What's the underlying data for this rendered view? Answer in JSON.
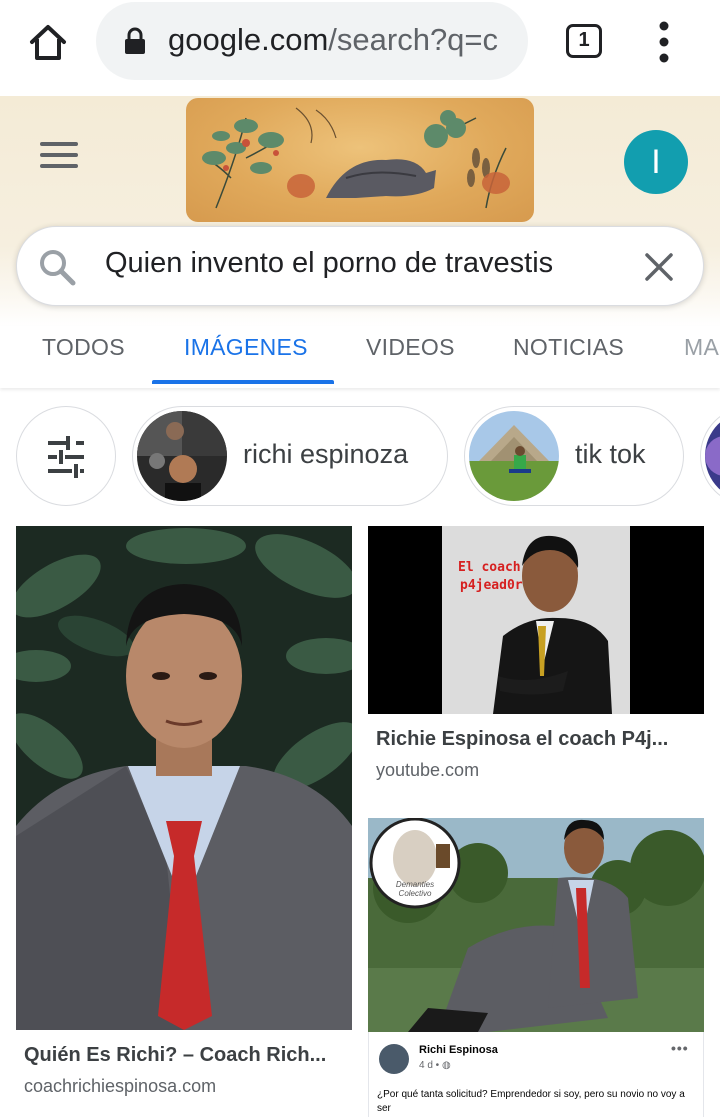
{
  "browser": {
    "url_host": "google.com",
    "url_path": "/search?q=c",
    "tab_count": "1",
    "icons": {
      "home": "home-icon",
      "lock": "lock-icon",
      "menu": "more-vert-icon"
    }
  },
  "header": {
    "avatar_letter": "I",
    "avatar_color": "#129eaf",
    "doodle": "google-doodle"
  },
  "search": {
    "query": "Quien invento el porno de travestis"
  },
  "tabs": [
    {
      "label": "TODOS",
      "active": false
    },
    {
      "label": "IMÁGENES",
      "active": true
    },
    {
      "label": "VIDEOS",
      "active": false
    },
    {
      "label": "NOTICIAS",
      "active": false
    },
    {
      "label": "MA",
      "active": false
    }
  ],
  "chips": [
    {
      "label": "richi espinoza"
    },
    {
      "label": "tik tok"
    }
  ],
  "results": [
    {
      "title": "Quién Es Richi? – Coach Rich...",
      "source": "coachrichiespinosa.com"
    },
    {
      "title": "Richie Espinosa el coach P4j...",
      "source": "youtube.com",
      "overlay": [
        "El coach",
        "p4jead0r"
      ]
    },
    {
      "fb_name": "Richi Espinosa",
      "fb_meta": "4 d • ",
      "fb_text": "¿Por qué tanta solicitud? Emprendedor si soy, pero su novio no voy a ser",
      "logo_text": "Demanties Colectivo"
    }
  ],
  "colors": {
    "accent": "#1a73e8",
    "text_secondary": "#5f6368"
  }
}
